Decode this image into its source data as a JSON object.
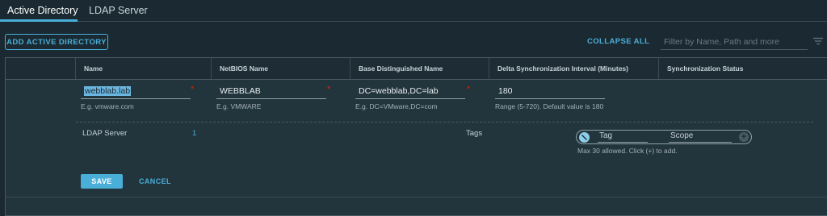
{
  "tabs": [
    {
      "label": "Active Directory",
      "active": true
    },
    {
      "label": "LDAP Server",
      "active": false
    }
  ],
  "toolbar": {
    "add_label": "ADD ACTIVE DIRECTORY",
    "collapse_label": "COLLAPSE ALL",
    "filter_placeholder": "Filter by Name, Path and more"
  },
  "grid": {
    "columns": [
      "Name",
      "NetBIOS Name",
      "Base Distinguished Name",
      "Delta Synchronization Interval (Minutes)",
      "Synchronization Status"
    ]
  },
  "form": {
    "name": {
      "value": "webblab.lab",
      "hint": "E.g. vmware.com"
    },
    "netbios": {
      "value": "WEBBLAB",
      "hint": "E.g. VMWARE"
    },
    "base_dn": {
      "value": "DC=webblab,DC=lab",
      "hint": "E.g. DC=VMware,DC=com"
    },
    "interval": {
      "value": "180",
      "hint": "Range (5-720). Default value is 180"
    },
    "required_mark": "*",
    "ldap_server_label": "LDAP Server",
    "ldap_server_count": "1",
    "tags_label": "Tags",
    "tag_placeholder": "Tag",
    "scope_placeholder": "Scope",
    "tags_hint": "Max 30 allowed. Click (+) to add.",
    "add_tag_symbol": "+",
    "save_label": "SAVE",
    "cancel_label": "CANCEL"
  },
  "colors": {
    "accent": "#49afd9",
    "required": "#e12200",
    "background": "#1b2a32"
  }
}
